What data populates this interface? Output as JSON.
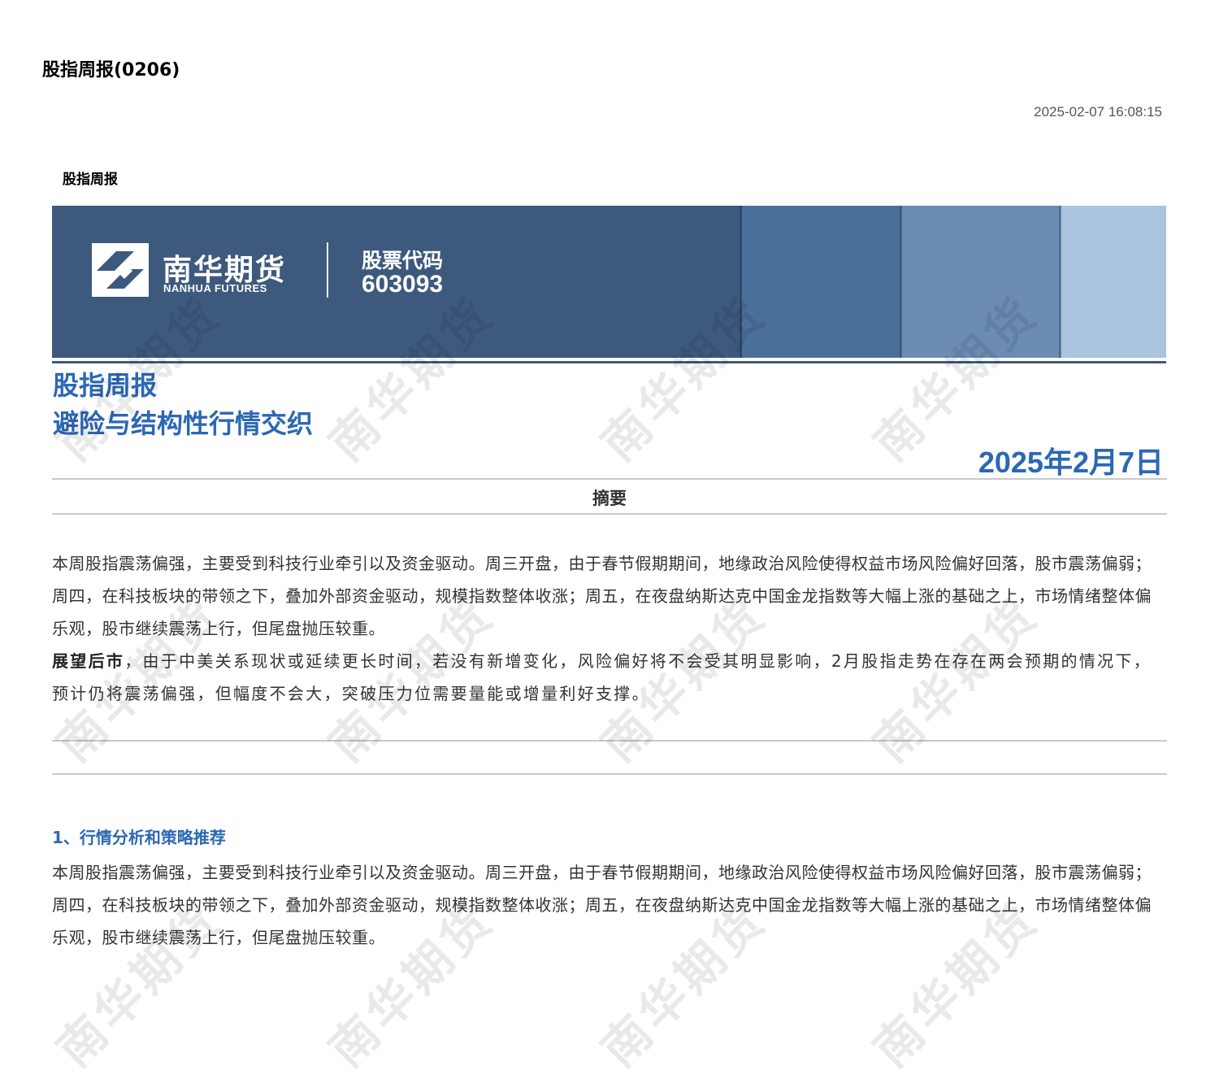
{
  "header": {
    "title": "股指周报(0206)",
    "timestamp": "2025-02-07 16:08:15",
    "section_tag": "股指周报"
  },
  "banner": {
    "logo_cn": "南华期货",
    "logo_en": "NANHUA FUTURES",
    "stock_label": "股票代码",
    "stock_code": "603093"
  },
  "report": {
    "name": "股指周报",
    "subtitle": "避险与结构性行情交织",
    "date": "2025年2月7日"
  },
  "summary": {
    "heading": "摘要",
    "paragraph": "本周股指震荡偏强，主要受到科技行业牵引以及资金驱动。周三开盘，由于春节假期期间，地缘政治风险使得权益市场风险偏好回落，股市震荡偏弱；周四，在科技板块的带领之下，叠加外部资金驱动，规模指数整体收涨；周五，在夜盘纳斯达克中国金龙指数等大幅上涨的基础之上，市场情绪整体偏乐观，股市继续震荡上行，但尾盘抛压较重。",
    "outlook_label": "展望后市",
    "outlook_text": "，由于中美关系现状或延续更长时间，若没有新增变化，风险偏好将不会受其明显影响，2月股指走势在存在两会预期的情况下，预计仍将震荡偏强，但幅度不会大，突破压力位需要量能或增量利好支撑。"
  },
  "section1": {
    "heading": "1、行情分析和策略推荐",
    "paragraph": "本周股指震荡偏强，主要受到科技行业牵引以及资金驱动。周三开盘，由于春节假期期间，地缘政治风险使得权益市场风险偏好回落，股市震荡偏弱；周四，在科技板块的带领之下，叠加外部资金驱动，规模指数整体收涨；周五，在夜盘纳斯达克中国金龙指数等大幅上涨的基础之上，市场情绪整体偏乐观，股市继续震荡上行，但尾盘抛压较重。"
  },
  "watermark": {
    "text": "南华期货"
  },
  "colors": {
    "accent_blue": "#2c68b4",
    "banner_dark": "#3d5a7e",
    "banner_mid": "#4b6f9b",
    "banner_light": "#6b8db4",
    "banner_lightest": "#aac4dd"
  }
}
